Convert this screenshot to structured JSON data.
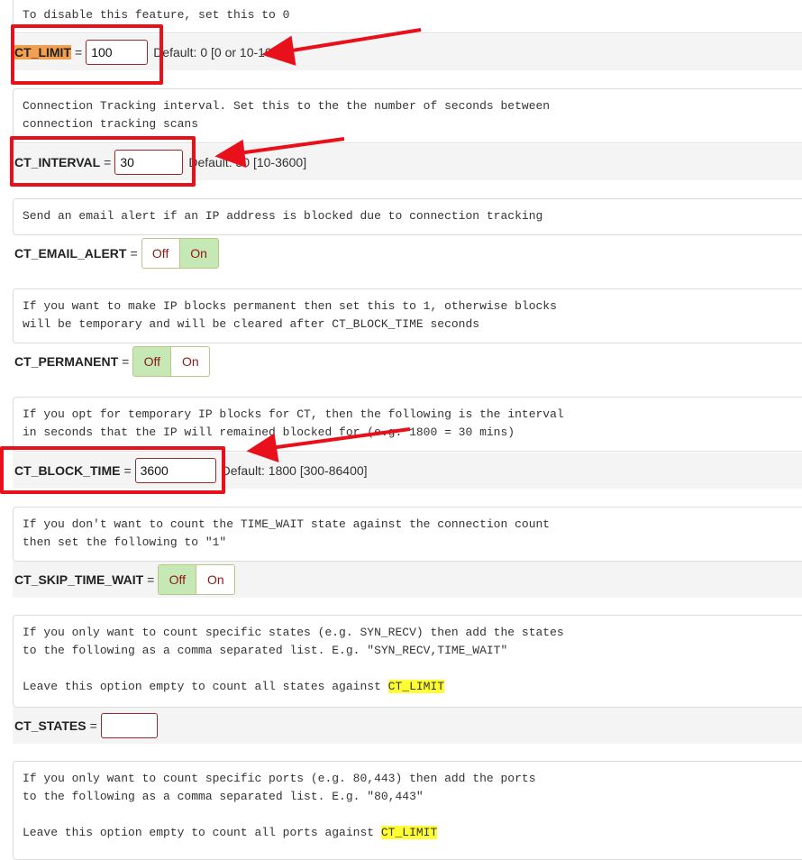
{
  "top_comment": "To disable this feature, set this to 0",
  "settings": [
    {
      "label": "CT_LIMIT",
      "eq": "=",
      "value": "100",
      "default": "Default: 0 [0 or 10-1000]"
    },
    {
      "comment": "Connection Tracking interval. Set this to the the number of seconds between\nconnection tracking scans",
      "label": "CT_INTERVAL",
      "eq": "=",
      "value": "30",
      "default": "Default: 30 [10-3600]"
    },
    {
      "comment": "Send an email alert if an IP address is blocked due to connection tracking",
      "label": "CT_EMAIL_ALERT",
      "eq": "=",
      "off": "Off",
      "on": "On",
      "state": "on"
    },
    {
      "comment": "If you want to make IP blocks permanent then set this to 1, otherwise blocks\nwill be temporary and will be cleared after CT_BLOCK_TIME seconds",
      "label": "CT_PERMANENT",
      "eq": "=",
      "off": "Off",
      "on": "On",
      "state": "off"
    },
    {
      "comment": "If you opt for temporary IP blocks for CT, then the following is the interval\nin seconds that the IP will remained blocked for (e.g. 1800 = 30 mins)",
      "label": "CT_BLOCK_TIME",
      "eq": "=",
      "value": "3600",
      "default": "Default: 1800 [300-86400]"
    },
    {
      "comment": "If you don't want to count the TIME_WAIT state against the connection count\nthen set the following to \"1\"",
      "label": "CT_SKIP_TIME_WAIT",
      "eq": "=",
      "off": "Off",
      "on": "On",
      "state": "off"
    },
    {
      "comment_a": "If you only want to count specific states (e.g. SYN_RECV) then add the states\nto the following as a comma separated list. E.g. \"SYN_RECV,TIME_WAIT\"\n\nLeave this option empty to count all states against ",
      "comment_hl": "CT_LIMIT",
      "label": "CT_STATES",
      "eq": "=",
      "value": ""
    },
    {
      "comment_a": "If you only want to count specific ports (e.g. 80,443) then add the ports\nto the following as a comma separated list. E.g. \"80,443\"\n\nLeave this option empty to count all ports against ",
      "comment_hl": "CT_LIMIT"
    }
  ],
  "colors": {
    "annotation_red": "#e8101a",
    "toggle_active": "#c6e8b4",
    "label_highlight": "#f0a050",
    "word_highlight": "#ffff33"
  }
}
